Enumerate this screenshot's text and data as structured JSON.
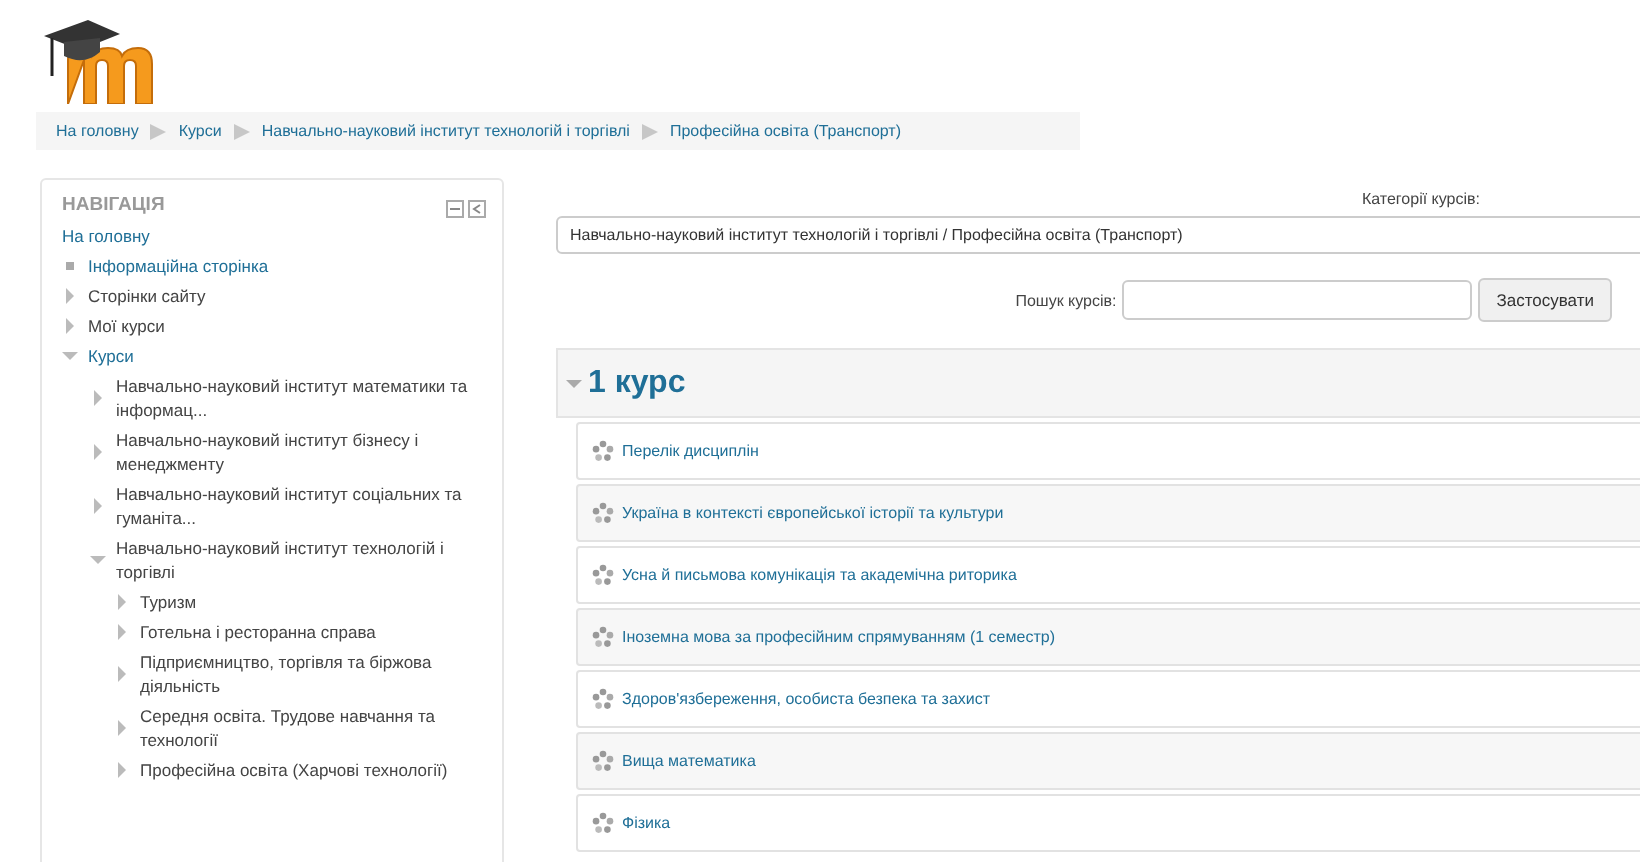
{
  "breadcrumb": [
    "На головну",
    "Курси",
    "Навчально-науковий інститут технологій і торгівлі",
    "Професійна освіта (Транспорт)"
  ],
  "navigation": {
    "title": "НАВІГАЦІЯ",
    "items": [
      {
        "label": "На головну",
        "kind": "home"
      },
      {
        "label": "Інформаційна сторінка",
        "kind": "page"
      },
      {
        "label": "Сторінки сайту",
        "kind": "branch",
        "linked": false,
        "expanded": false
      },
      {
        "label": "Мої курси",
        "kind": "branch",
        "linked": false,
        "expanded": false
      },
      {
        "label": "Курси",
        "kind": "branch",
        "linked": true,
        "expanded": true,
        "children": [
          {
            "label": "Навчально-науковий інститут математики та інформац...",
            "kind": "branch",
            "linked": false,
            "expanded": false
          },
          {
            "label": "Навчально-науковий інститут бізнесу і менеджменту",
            "kind": "branch",
            "linked": false,
            "expanded": false
          },
          {
            "label": "Навчально-науковий інститут соціальних та гуманіта...",
            "kind": "branch",
            "linked": false,
            "expanded": false
          },
          {
            "label": "Навчально-науковий інститут технологій і торгівлі",
            "kind": "branch",
            "linked": false,
            "expanded": true,
            "children": [
              {
                "label": "Туризм",
                "kind": "branch",
                "linked": false,
                "expanded": false
              },
              {
                "label": "Готельна і ресторанна справа",
                "kind": "branch",
                "linked": false,
                "expanded": false
              },
              {
                "label": "Підприємництво, торгівля та біржова діяльність",
                "kind": "branch",
                "linked": false,
                "expanded": false
              },
              {
                "label": "Середня освіта. Трудове навчання та технології",
                "kind": "branch",
                "linked": false,
                "expanded": false
              },
              {
                "label": "Професійна освіта (Харчові технології)",
                "kind": "branch",
                "linked": false,
                "expanded": false
              }
            ]
          }
        ]
      }
    ]
  },
  "categories": {
    "label": "Категорії курсів:",
    "value": "Навчально-науковий інститут технологій і торгівлі / Професійна освіта (Транспорт)"
  },
  "search": {
    "label": "Пошук курсів:",
    "button": "Застосувати"
  },
  "section": {
    "title": "1 курс",
    "expanded": true,
    "courses": [
      "Перелік дисциплін",
      "Україна в контексті європейської історії та культури",
      "Усна й письмова комунікація та академічна риторика",
      "Іноземна мова за професійним спрямуванням (1 семестр)",
      "Здоров'язбереження, особиста безпека та захист",
      "Вища математика",
      "Фізика"
    ]
  }
}
